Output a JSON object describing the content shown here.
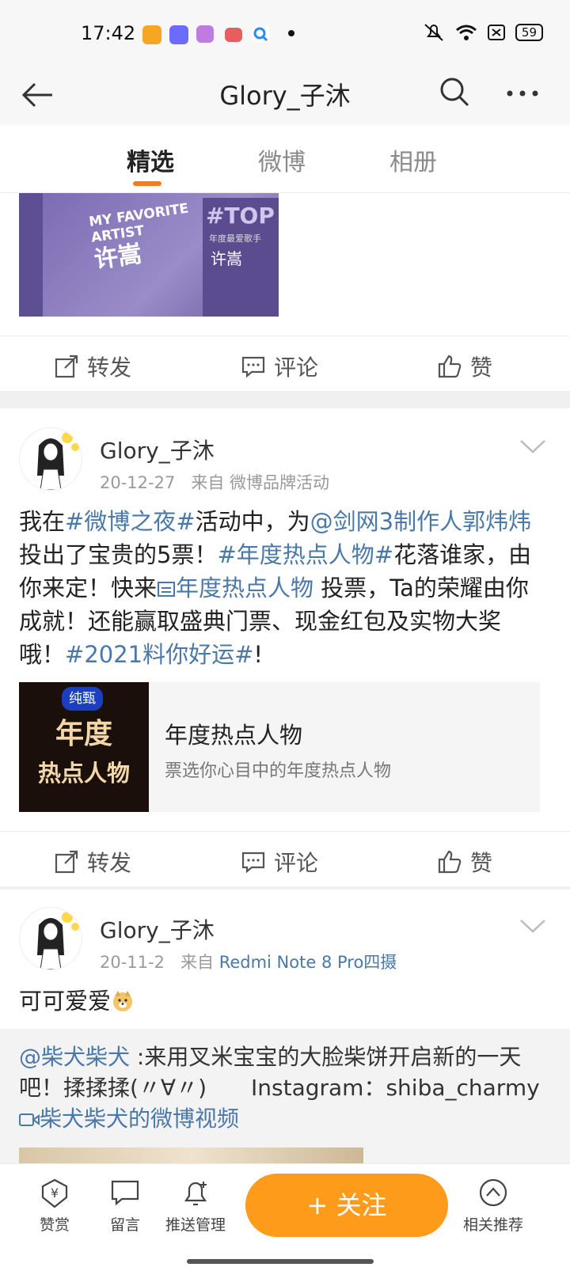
{
  "status_bar": {
    "time": "17:42",
    "battery": "59"
  },
  "nav": {
    "title": "Glory_子沐"
  },
  "tabs": [
    {
      "label": "精选"
    },
    {
      "label": "微博"
    },
    {
      "label": "相册"
    }
  ],
  "top_image": {
    "lines": [
      "MY FAVORITE",
      "ARTIST",
      "许嵩",
      "#TOP",
      "年度最爱歌手",
      "许嵩"
    ]
  },
  "actions": {
    "repost": "转发",
    "comment": "评论",
    "like": "赞"
  },
  "post1": {
    "username": "Glory_子沐",
    "date": "20-12-27",
    "from_label": "来自",
    "source": "微博品牌活动",
    "text_parts": {
      "p1": "我在",
      "h1": "#微博之夜#",
      "p2": "活动中，为",
      "m1": "@剑网3制作人郭炜炜",
      "p3": " 投出了宝贵的5票！",
      "h2": "#年度热点人物#",
      "p4": "花落谁家，由你来定！快来",
      "l1": "年度热点人物",
      "p5": " 投票，Ta的荣耀由你成就！还能赢取盛典门票、现金红包及实物大奖哦！",
      "h3": "#2021料你好运#",
      "p6": "!"
    },
    "card": {
      "badge": "纯甄",
      "thumb_line1": "年度",
      "thumb_line2": "热点人物",
      "title": "年度热点人物",
      "subtitle": "票选你心目中的年度热点人物"
    }
  },
  "post2": {
    "username": "Glory_子沐",
    "date": "20-11-2",
    "from_label": "来自",
    "source": "Redmi Note 8 Pro四摄",
    "text": "可可爱爱",
    "repost": {
      "mention": "@柴犬柴犬",
      "text": " :来用叉米宝宝的大脸柴饼开启新的一天吧！揉揉揉(〃∀〃)　　Instagram：shiba_charmy",
      "video_link": "柴犬柴犬的微博视频"
    }
  },
  "bottom_bar": {
    "tip": "赞赏",
    "message": "留言",
    "push": "推送管理",
    "follow": "+ 关注",
    "related": "相关推荐"
  }
}
